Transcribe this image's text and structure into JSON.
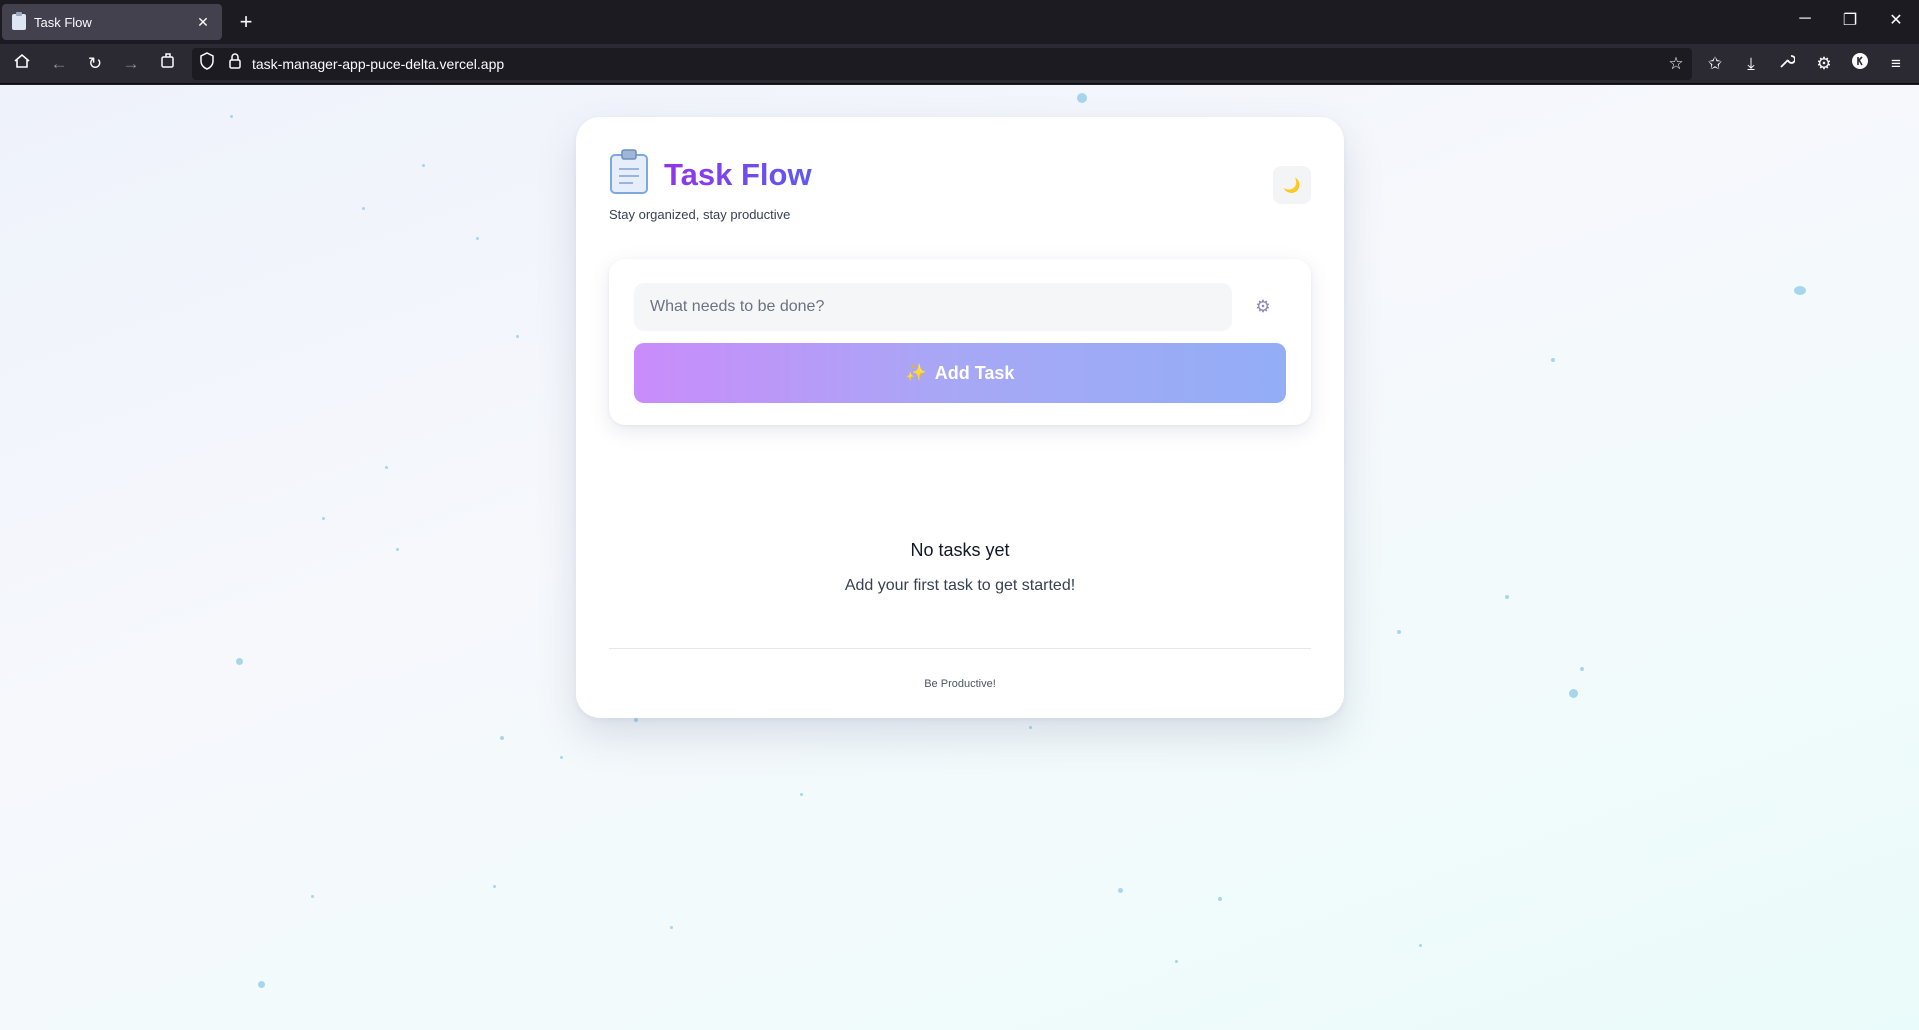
{
  "browser": {
    "tab_title": "Task Flow",
    "tab_close": "✕",
    "new_tab": "+",
    "url": "task-manager-app-puce-delta.vercel.app",
    "window_controls": {
      "minimize": "─",
      "restore": "❐",
      "close": "✕"
    }
  },
  "app": {
    "title": "Task Flow",
    "subtitle": "Stay organized, stay productive",
    "theme_toggle_icon": "🌙",
    "input": {
      "placeholder": "What needs to be done?",
      "value": ""
    },
    "settings_icon": "gear-icon",
    "add_button": {
      "icon": "✨",
      "label": "Add Task"
    },
    "empty_state": {
      "title": "No tasks yet",
      "subtitle": "Add your first task to get started!"
    },
    "footer": "Be Productive!"
  },
  "colors": {
    "title_gradient_start": "#9333ea",
    "title_gradient_end": "#5b5bf0",
    "button_gradient_start": "#c98cfb",
    "button_gradient_end": "#93adf7"
  }
}
